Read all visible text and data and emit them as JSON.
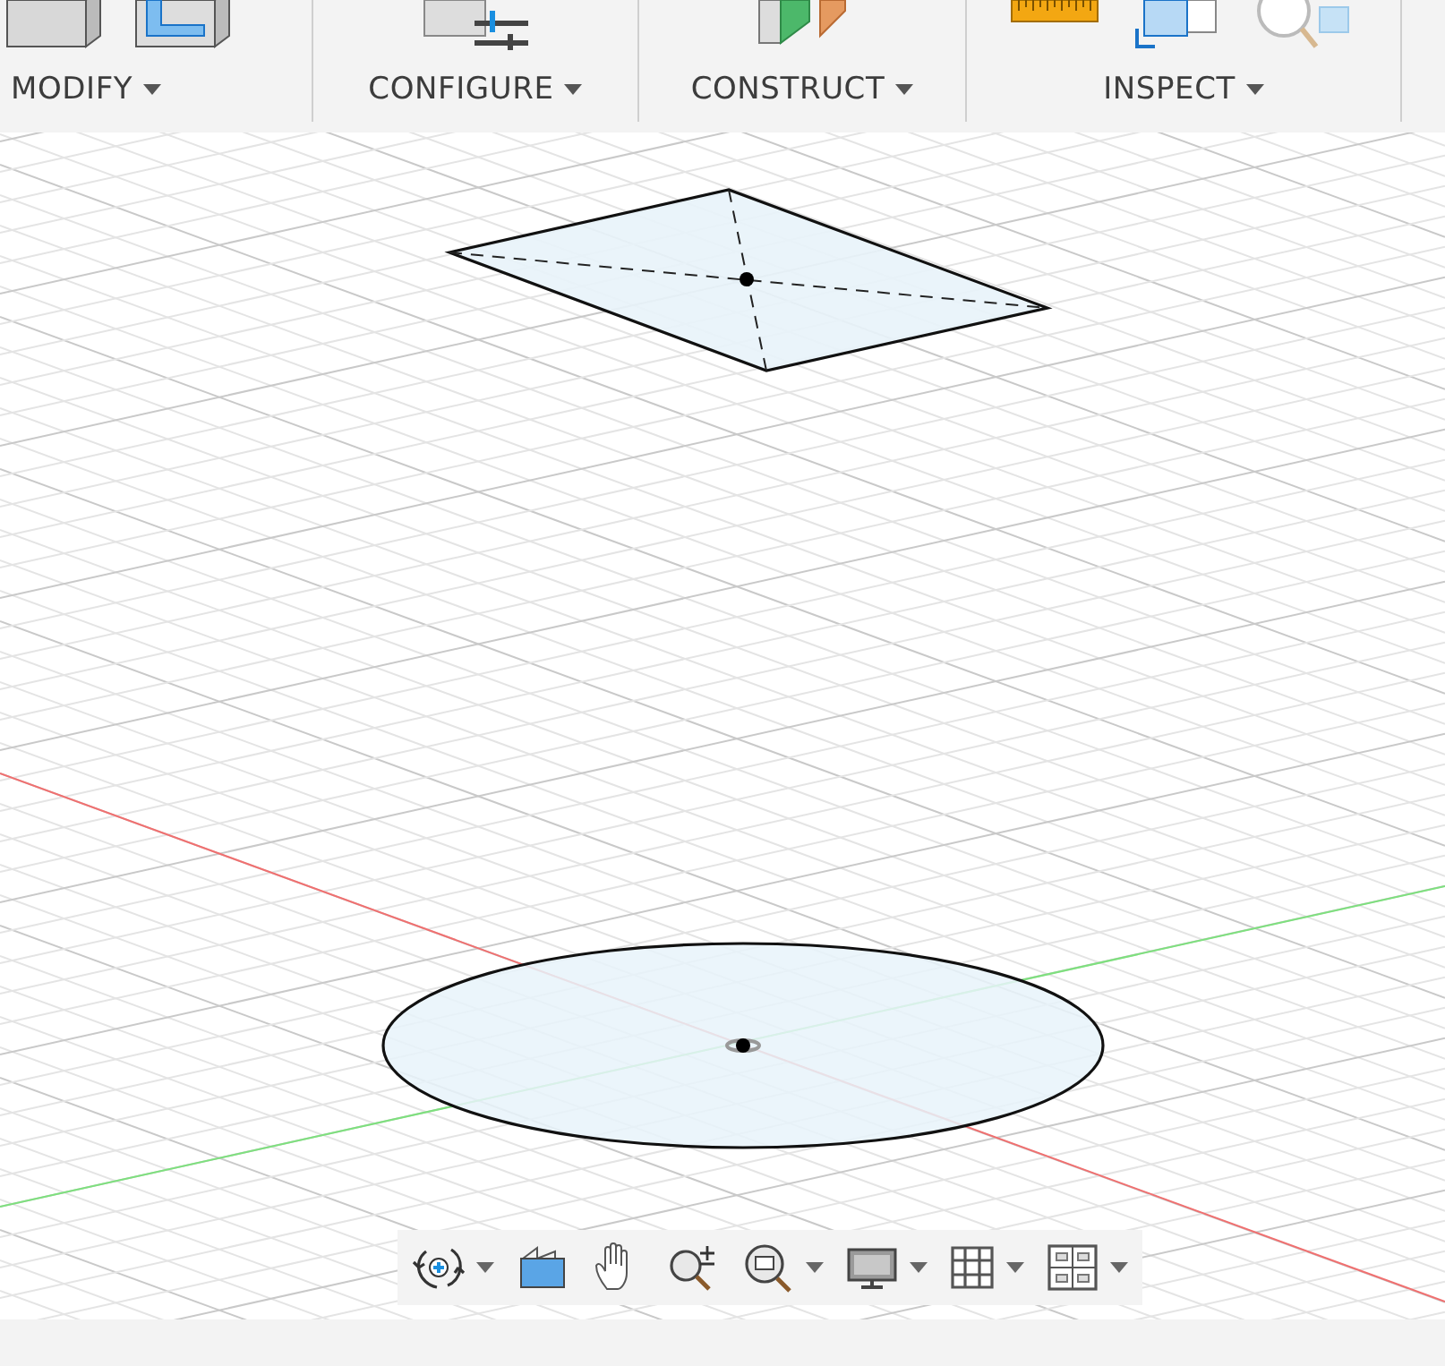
{
  "toolbar": {
    "groups": [
      {
        "label": "MODIFY",
        "icons": [
          {
            "kind": "box"
          },
          {
            "kind": "box-blue"
          }
        ]
      },
      {
        "label": "CONFIGURE",
        "icons": [
          {
            "kind": "config"
          }
        ]
      },
      {
        "label": "CONSTRUCT",
        "icons": [
          {
            "kind": "plane"
          }
        ]
      },
      {
        "label": "INSPECT",
        "icons": [
          {
            "kind": "ruler"
          },
          {
            "kind": "section"
          },
          {
            "kind": "zoom-cube"
          }
        ]
      }
    ]
  },
  "viewport": {
    "sketches": [
      {
        "kind": "rectangle"
      },
      {
        "kind": "circle"
      }
    ]
  },
  "nav_bar": {
    "tools": [
      {
        "kind": "orbit",
        "dropdown": true
      },
      {
        "kind": "look",
        "dropdown": false
      },
      {
        "kind": "pan",
        "dropdown": false
      },
      {
        "kind": "zoom",
        "dropdown": false
      },
      {
        "kind": "fit",
        "dropdown": true
      },
      {
        "kind": "display",
        "dropdown": true
      },
      {
        "kind": "grid",
        "dropdown": true
      },
      {
        "kind": "viewports",
        "dropdown": true
      }
    ]
  }
}
